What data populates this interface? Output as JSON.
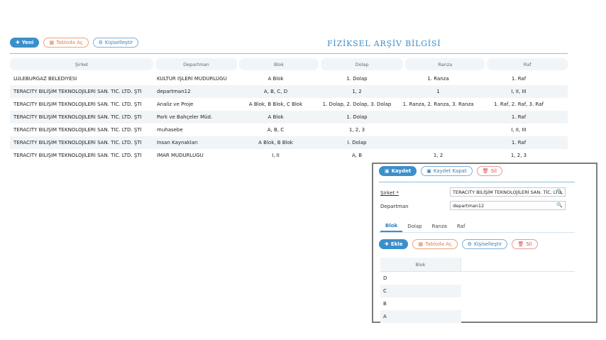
{
  "toolbar": {
    "new_label": "Yeni",
    "table_label": "Tabloda Aç",
    "customize_label": "Kişiselleştir"
  },
  "page_title": "FİZİKSEL ARŞİV BİLGİSİ",
  "grid": {
    "columns": [
      "Şirket",
      "Departman",
      "Blok",
      "Dolap",
      "Ranza",
      "Raf"
    ],
    "rows": [
      [
        "LÜLEBURGAZ BELEDİYESİ",
        "KÜLTÜR İŞLERİ MÜDÜRLÜĞÜ",
        "A Blok",
        "1. Dolap",
        "1. Ranza",
        "1. Raf"
      ],
      [
        "TERACITY BİLİŞİM TEKNOLOJİLERİ SAN. TİC. LTD. ŞTİ",
        "departman12",
        "A, B, C, D",
        "1, 2",
        "1",
        "I, II, III"
      ],
      [
        "TERACITY BİLİŞİM TEKNOLOJİLERİ SAN. TİC. LTD. ŞTİ",
        "Analiz ve Proje",
        "A Blok, B Blok, C Blok",
        "1. Dolap, 2. Dolap, 3. Dolap",
        "1. Ranza, 2. Ranza, 3. Ranza",
        "1. Raf, 2. Raf, 3. Raf"
      ],
      [
        "TERACITY BİLİŞİM TEKNOLOJİLERİ SAN. TİC. LTD. ŞTİ",
        "Park ve Bahçeler Müd.",
        "A Blok",
        "1. Dolap",
        "",
        "1. Raf"
      ],
      [
        "TERACITY BİLİŞİM TEKNOLOJİLERİ SAN. TİC. LTD. ŞTİ",
        "muhasebe",
        "A, B, C",
        "1, 2, 3",
        "",
        "I, II, III"
      ],
      [
        "TERACITY BİLİŞİM TEKNOLOJİLERİ SAN. TİC. LTD. ŞTİ",
        "İnsan Kaynakları",
        "A Blok, B Blok",
        "I. Dolap",
        "",
        "1. Raf"
      ],
      [
        "TERACITY BİLİŞİM TEKNOLOJİLERİ SAN. TİC. LTD. ŞTİ",
        "İMAR MÜDÜRLÜĞÜ",
        "I, II",
        "A, B",
        "1, 2",
        "1, 2, 3"
      ]
    ]
  },
  "panel": {
    "save_label": "Kaydet",
    "save_close_label": "Kaydet Kapat",
    "delete_label": "Sil",
    "company_label": "Şirket *",
    "company_value": "TERACITY BİLİŞİM TEKNOLOJİLERİ SAN. TİC. LTD. ŞTİ",
    "department_label": "Departman",
    "department_value": "departman12",
    "tabs": [
      "Blok",
      "Dolap",
      "Ranza",
      "Raf"
    ],
    "add_label": "Ekle",
    "table_label": "Tabloda Aç",
    "customize_label": "Kişiselleştir",
    "sub_delete_label": "Sil",
    "sub_grid": {
      "header": "Blok",
      "rows": [
        "D",
        "C",
        "B",
        "A"
      ]
    }
  }
}
